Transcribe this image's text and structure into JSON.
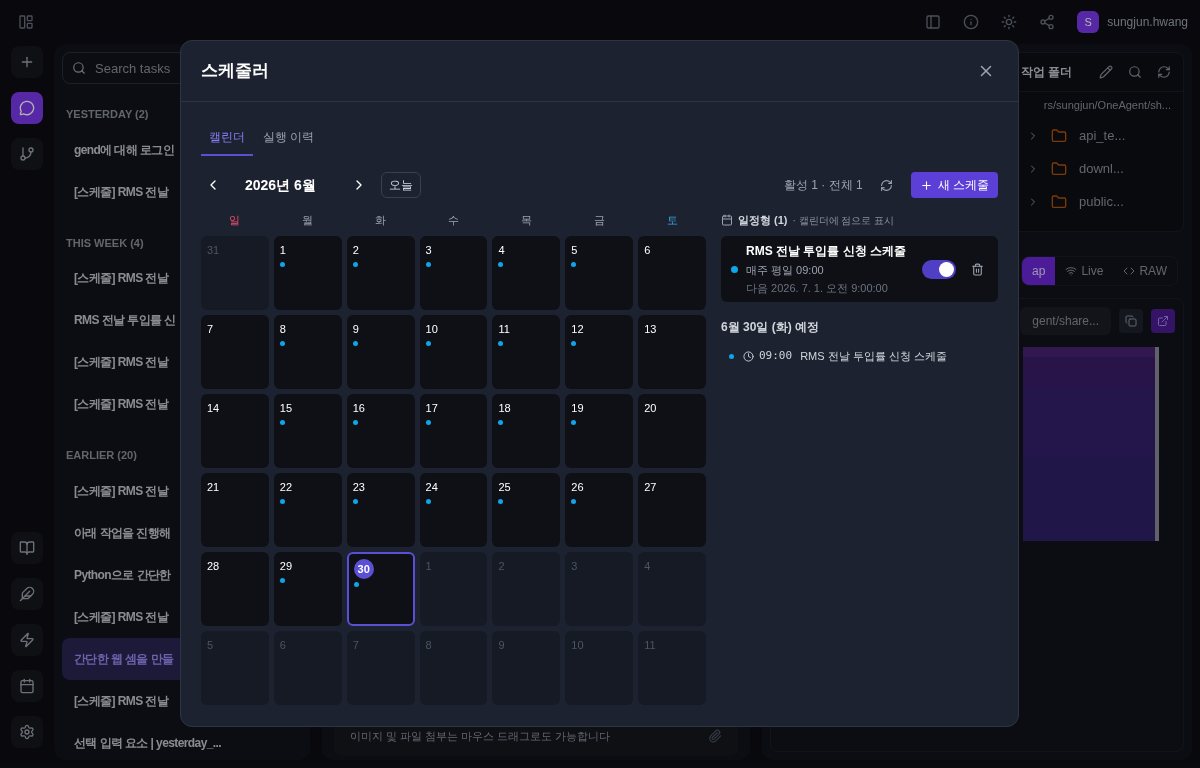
{
  "topbar": {
    "user": {
      "initial": "S",
      "name": "sungjun.hwang"
    }
  },
  "rail": {
    "top": [
      {
        "kind": "plus",
        "selected": false
      },
      {
        "kind": "chat",
        "selected": true
      },
      {
        "kind": "branch",
        "selected": false
      }
    ],
    "bottom": [
      {
        "kind": "book",
        "selected": false
      },
      {
        "kind": "feather",
        "selected": false
      },
      {
        "kind": "zap",
        "selected": false
      },
      {
        "kind": "calendar",
        "selected": false
      },
      {
        "kind": "settings",
        "selected": false
      }
    ]
  },
  "tasks": {
    "search": {
      "placeholder": "Search tasks"
    },
    "groups": [
      {
        "title": "YESTERDAY (2)",
        "items": [
          {
            "label": "gend에 대해 로그인",
            "selected": false
          },
          {
            "label": "[스케줄] RMS 전날",
            "selected": false
          }
        ]
      },
      {
        "title": "THIS WEEK (4)",
        "items": [
          {
            "label": "[스케줄] RMS 전날",
            "selected": false
          },
          {
            "label": "RMS 전날 투입률 신",
            "selected": false
          },
          {
            "label": "[스케줄] RMS 전날",
            "selected": false
          },
          {
            "label": "[스케줄] RMS 전날",
            "selected": false
          }
        ]
      },
      {
        "title": "EARLIER (20)",
        "items": [
          {
            "label": "[스케줄] RMS 전날",
            "selected": false
          },
          {
            "label": "아래 작업을 진행해",
            "selected": false
          },
          {
            "label": "Python으로 간단한",
            "selected": false
          },
          {
            "label": "[스케줄] RMS 전날",
            "selected": false
          },
          {
            "label": "간단한 웹 셈을 만들",
            "selected": true
          },
          {
            "label": "[스케줄] RMS 전날",
            "selected": false
          },
          {
            "label": "선택 입력 요소 | yesterday_...",
            "selected": false
          }
        ]
      }
    ]
  },
  "composer": {
    "hint": "이미지 및 파일 첨부는 마우스 드래그로도 가능합니다"
  },
  "workspace": {
    "title": "작업 폴더",
    "path": "rs/sungjun/OneAgent/sh...",
    "folders": [
      {
        "name": "api_te..."
      },
      {
        "name": "downl..."
      },
      {
        "name": "public..."
      }
    ],
    "tabs": [
      {
        "label": "ap",
        "selected": true
      },
      {
        "label": "Live",
        "selected": false
      },
      {
        "label": "RAW",
        "selected": false
      }
    ],
    "url": "gent/share..."
  },
  "modal": {
    "title": "스케줄러",
    "tabs": [
      {
        "label": "캘린더",
        "selected": true
      },
      {
        "label": "실행 이력",
        "selected": false
      }
    ],
    "month": "2026년 6월",
    "today": "오늘",
    "counts": "활성 1 · 전체 1",
    "new_button": "새 스케줄",
    "weekdays": [
      {
        "label": "일",
        "kind": "sun"
      },
      {
        "label": "월",
        "kind": "day"
      },
      {
        "label": "화",
        "kind": "day"
      },
      {
        "label": "수",
        "kind": "day"
      },
      {
        "label": "목",
        "kind": "day"
      },
      {
        "label": "금",
        "kind": "day"
      },
      {
        "label": "토",
        "kind": "sat"
      }
    ],
    "days": [
      {
        "day": "31",
        "outside": true,
        "event": false,
        "selected": false
      },
      {
        "day": "1",
        "outside": false,
        "event": true,
        "selected": false
      },
      {
        "day": "2",
        "outside": false,
        "event": true,
        "selected": false
      },
      {
        "day": "3",
        "outside": false,
        "event": true,
        "selected": false
      },
      {
        "day": "4",
        "outside": false,
        "event": true,
        "selected": false
      },
      {
        "day": "5",
        "outside": false,
        "event": true,
        "selected": false
      },
      {
        "day": "6",
        "outside": false,
        "event": false,
        "selected": false
      },
      {
        "day": "7",
        "outside": false,
        "event": false,
        "selected": false
      },
      {
        "day": "8",
        "outside": false,
        "event": true,
        "selected": false
      },
      {
        "day": "9",
        "outside": false,
        "event": true,
        "selected": false
      },
      {
        "day": "10",
        "outside": false,
        "event": true,
        "selected": false
      },
      {
        "day": "11",
        "outside": false,
        "event": true,
        "selected": false
      },
      {
        "day": "12",
        "outside": false,
        "event": true,
        "selected": false
      },
      {
        "day": "13",
        "outside": false,
        "event": false,
        "selected": false
      },
      {
        "day": "14",
        "outside": false,
        "event": false,
        "selected": false
      },
      {
        "day": "15",
        "outside": false,
        "event": true,
        "selected": false
      },
      {
        "day": "16",
        "outside": false,
        "event": true,
        "selected": false
      },
      {
        "day": "17",
        "outside": false,
        "event": true,
        "selected": false
      },
      {
        "day": "18",
        "outside": false,
        "event": true,
        "selected": false
      },
      {
        "day": "19",
        "outside": false,
        "event": true,
        "selected": false
      },
      {
        "day": "20",
        "outside": false,
        "event": false,
        "selected": false
      },
      {
        "day": "21",
        "outside": false,
        "event": false,
        "selected": false
      },
      {
        "day": "22",
        "outside": false,
        "event": true,
        "selected": false
      },
      {
        "day": "23",
        "outside": false,
        "event": true,
        "selected": false
      },
      {
        "day": "24",
        "outside": false,
        "event": true,
        "selected": false
      },
      {
        "day": "25",
        "outside": false,
        "event": true,
        "selected": false
      },
      {
        "day": "26",
        "outside": false,
        "event": true,
        "selected": false
      },
      {
        "day": "27",
        "outside": false,
        "event": false,
        "selected": false
      },
      {
        "day": "28",
        "outside": false,
        "event": false,
        "selected": false
      },
      {
        "day": "29",
        "outside": false,
        "event": true,
        "selected": false
      },
      {
        "day": "30",
        "outside": false,
        "event": true,
        "selected": true
      },
      {
        "day": "1",
        "outside": true,
        "event": false,
        "selected": false
      },
      {
        "day": "2",
        "outside": true,
        "event": false,
        "selected": false
      },
      {
        "day": "3",
        "outside": true,
        "event": false,
        "selected": false
      },
      {
        "day": "4",
        "outside": true,
        "event": false,
        "selected": false
      },
      {
        "day": "5",
        "outside": true,
        "event": false,
        "selected": false
      },
      {
        "day": "6",
        "outside": true,
        "event": false,
        "selected": false
      },
      {
        "day": "7",
        "outside": true,
        "event": false,
        "selected": false
      },
      {
        "day": "8",
        "outside": true,
        "event": false,
        "selected": false
      },
      {
        "day": "9",
        "outside": true,
        "event": false,
        "selected": false
      },
      {
        "day": "10",
        "outside": true,
        "event": false,
        "selected": false
      },
      {
        "day": "11",
        "outside": true,
        "event": false,
        "selected": false
      }
    ],
    "section": {
      "title": "일정형 (1)",
      "note": "· 캘린더에 점으로 표시"
    },
    "schedules": [
      {
        "title": "RMS 전날 투입률 신청 스케줄",
        "recurrence": "매주 평일 09:00",
        "next": "다음 2026. 7. 1. 오전 9:00:00",
        "on": true
      }
    ],
    "agenda": {
      "title": "6월 30일 (화) 예정",
      "items": [
        {
          "time": "09:00",
          "title": "RMS 전날 투입률 신청 스케줄"
        }
      ]
    }
  }
}
